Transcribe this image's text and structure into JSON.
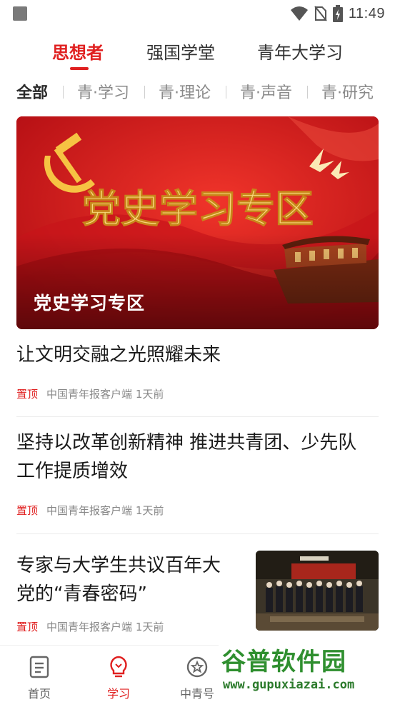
{
  "status_bar": {
    "time": "11:49",
    "icons": [
      "notification-square-icon",
      "wifi-icon",
      "no-sim-icon",
      "battery-charging-icon"
    ]
  },
  "top_tabs": [
    {
      "label": "思想者",
      "active": true
    },
    {
      "label": "强国学堂",
      "active": false
    },
    {
      "label": "青年大学习",
      "active": false
    }
  ],
  "sub_tabs": [
    {
      "label": "全部",
      "active": true
    },
    {
      "label": "青·学习",
      "active": false
    },
    {
      "label": "青·理论",
      "active": false
    },
    {
      "label": "青·声音",
      "active": false
    },
    {
      "label": "青·研究",
      "active": false
    }
  ],
  "banner": {
    "headline": "党史学习专区",
    "caption": "党史学习专区"
  },
  "articles": [
    {
      "title": "让文明交融之光照耀未来",
      "pin": "置顶",
      "source": "中国青年报客户端",
      "time": "1天前"
    },
    {
      "title_lines": [
        "坚持以改革创新精神 推进共青团、少先队",
        "工作提质增效"
      ],
      "pin": "置顶",
      "source": "中国青年报客户端",
      "time": "1天前"
    },
    {
      "title_lines": [
        "专家与大学生共议百年大",
        "党的“青春密码”"
      ],
      "pin": "置顶",
      "source": "中国青年报客户端",
      "time": "1天前",
      "has_thumbnail": true
    }
  ],
  "bottom_nav": [
    {
      "label": "首页",
      "icon": "document-icon",
      "active": false
    },
    {
      "label": "学习",
      "icon": "lightbulb-icon",
      "active": true
    },
    {
      "label": "中青号",
      "icon": "star-circle-icon",
      "active": false
    }
  ],
  "watermark": {
    "name": "谷普软件园",
    "url": "www.gupuxiazai.com"
  },
  "colors": {
    "accent": "#e02020",
    "banner_red": "#d4161b",
    "gold": "#f6c343",
    "watermark_green": "#2f8f2f"
  }
}
